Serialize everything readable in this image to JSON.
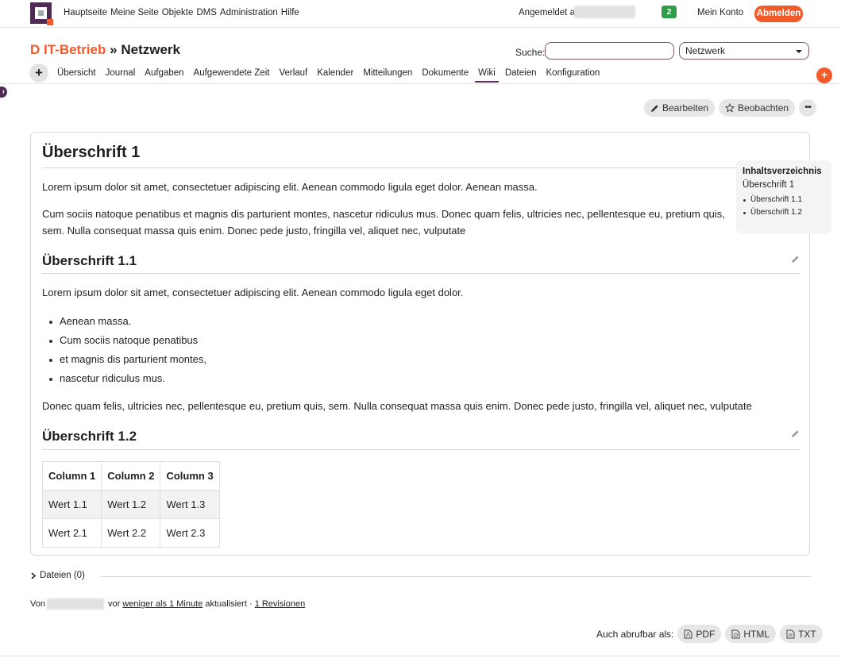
{
  "topbar": {
    "nav": [
      "Hauptseite",
      "Meine Seite",
      "Objekte",
      "DMS",
      "Administration",
      "Hilfe"
    ],
    "logged_in_label": "Angemeldet als",
    "notification_count": "2",
    "my_account": "Mein Konto",
    "logout": "Abmelden"
  },
  "header": {
    "parent_project": "D IT-Betrieb",
    "separator": "»",
    "project": "Netzwerk",
    "search_label": "Suche:",
    "search_value": "",
    "project_select_value": "Netzwerk"
  },
  "tabs": [
    {
      "label": "Übersicht",
      "active": false
    },
    {
      "label": "Journal",
      "active": false
    },
    {
      "label": "Aufgaben",
      "active": false
    },
    {
      "label": "Aufgewendete Zeit",
      "active": false
    },
    {
      "label": "Verlauf",
      "active": false
    },
    {
      "label": "Kalender",
      "active": false
    },
    {
      "label": "Mitteilungen",
      "active": false
    },
    {
      "label": "Dokumente",
      "active": false
    },
    {
      "label": "Wiki",
      "active": true
    },
    {
      "label": "Dateien",
      "active": false
    },
    {
      "label": "Konfiguration",
      "active": false
    }
  ],
  "actions": {
    "edit": "Bearbeiten",
    "watch": "Beobachten",
    "more": "•••"
  },
  "wiki": {
    "h1": "Überschrift 1",
    "p1": "Lorem ipsum dolor sit amet, consectetuer adipiscing elit. Aenean commodo ligula eget dolor. Aenean massa.",
    "p2": "Cum sociis natoque penatibus et magnis dis parturient montes, nascetur ridiculus mus. Donec quam felis, ultricies nec, pellentesque eu, pretium quis, sem. Nulla consequat massa quis enim. Donec pede justo, fringilla vel, aliquet nec, vulputate",
    "h2a": "Überschrift 1.1",
    "p3": "Lorem ipsum dolor sit amet, consectetuer adipiscing elit. Aenean commodo ligula eget dolor.",
    "list": [
      "Aenean massa.",
      "Cum sociis natoque penatibus",
      "et magnis dis parturient montes,",
      "nascetur ridiculus mus."
    ],
    "p4": "Donec quam felis, ultricies nec, pellentesque eu, pretium quis, sem. Nulla consequat massa quis enim. Donec pede justo, fringilla vel, aliquet nec, vulputate",
    "h2b": "Überschrift 1.2",
    "table": {
      "headers": [
        "Column 1",
        "Column 2",
        "Column 3"
      ],
      "rows": [
        [
          "Wert 1.1",
          "Wert 1.2",
          "Wert 1.3"
        ],
        [
          "Wert 2.1",
          "Wert 2.2",
          "Wert 2.3"
        ]
      ]
    }
  },
  "toc": {
    "title": "Inhaltsverzeichnis",
    "h1": "Überschrift 1",
    "items": [
      "Überschrift 1.1",
      "Überschrift 1.2"
    ]
  },
  "files": {
    "label": "Dateien (0)"
  },
  "updated": {
    "by": "Von",
    "vor": "vor",
    "time_link": "weniger als 1 Minute",
    "updated_text": "aktualisiert ·",
    "revisions_link": "1 Revisionen"
  },
  "export": {
    "label": "Auch abrufbar als:",
    "formats": [
      "PDF",
      "HTML",
      "TXT"
    ]
  },
  "colors": {
    "brand_orange": "#f15a29",
    "brand_purple": "#4e2a55",
    "badge_green": "#2e9e4a"
  }
}
